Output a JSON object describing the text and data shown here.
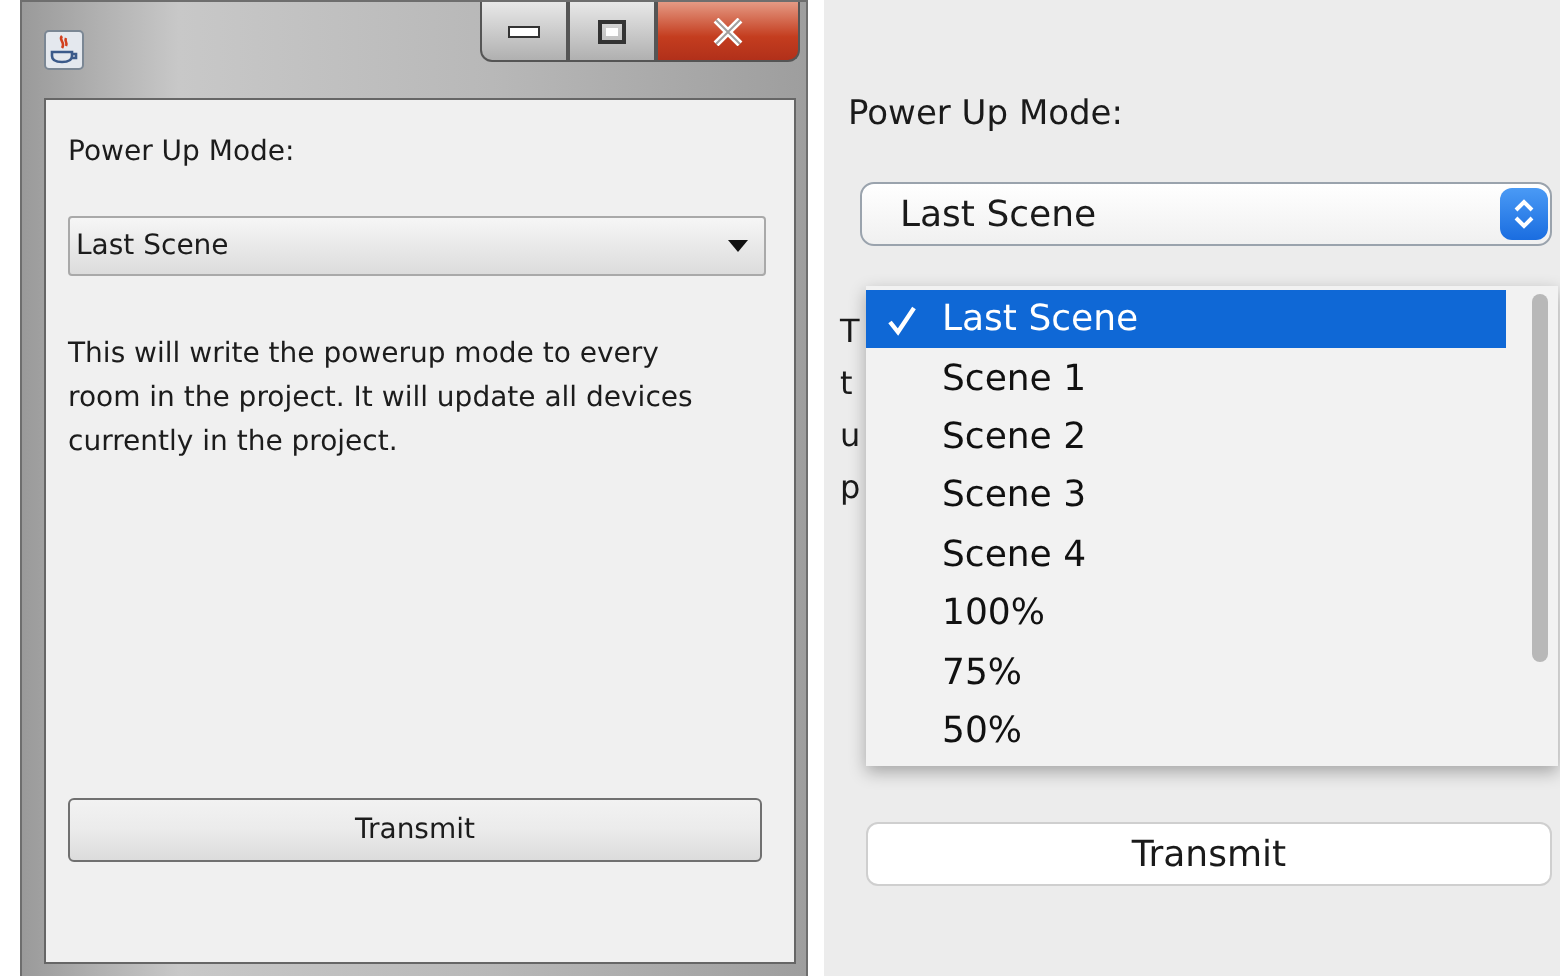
{
  "windows_dialog": {
    "label": "Power Up Mode:",
    "combo_value": "Last Scene",
    "description": "This will write the powerup mode to every room in the project. It will update all devices currently in the project.",
    "button": "Transmit"
  },
  "mac_dialog": {
    "label": "Power Up Mode:",
    "combo_value": "Last Scene",
    "description_visible_letters": [
      "T",
      "t",
      "u",
      "p"
    ],
    "menu_items": [
      {
        "label": "Last Scene",
        "selected": true
      },
      {
        "label": "Scene 1",
        "selected": false
      },
      {
        "label": "Scene 2",
        "selected": false
      },
      {
        "label": "Scene 3",
        "selected": false
      },
      {
        "label": "Scene 4",
        "selected": false
      },
      {
        "label": "100%",
        "selected": false
      },
      {
        "label": "75%",
        "selected": false
      },
      {
        "label": "50%",
        "selected": false
      }
    ],
    "button": "Transmit"
  }
}
